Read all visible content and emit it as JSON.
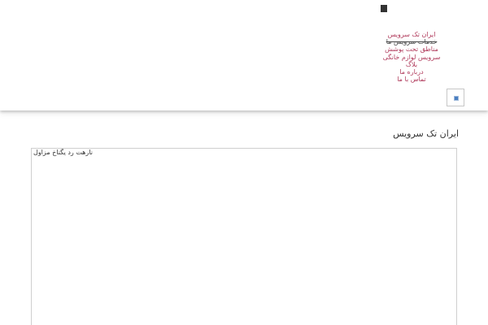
{
  "header": {
    "nav": {
      "items": [
        {
          "label": "ایران تک سرویس"
        },
        {
          "label": "خدمات سرویس ما"
        },
        {
          "label": "مناطق تحت پوشش"
        },
        {
          "label": "سرویس لوازم خانگی"
        },
        {
          "label": "بلاگ"
        },
        {
          "label": "درباره ما"
        },
        {
          "label": "تماس با ما"
        }
      ]
    },
    "menu_toggle_icon": "menu-icon"
  },
  "main": {
    "site_title": "ایران تک سرویس",
    "content_text": "نارهت رد یگناخ مزاول"
  },
  "colors": {
    "link": "#b03a5b",
    "text": "#333333",
    "border": "#cfcfcf"
  }
}
